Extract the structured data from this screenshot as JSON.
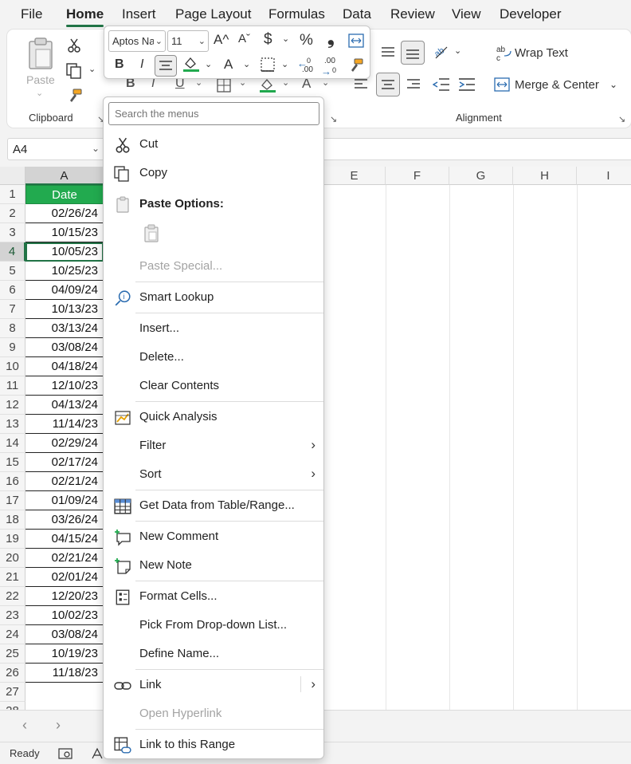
{
  "menu": {
    "tabs": [
      "File",
      "Home",
      "Insert",
      "Page Layout",
      "Formulas",
      "Data",
      "Review",
      "View",
      "Developer"
    ],
    "active_tab": "Home"
  },
  "ribbon": {
    "clipboard": {
      "group_label": "Clipboard",
      "paste_label": "Paste"
    },
    "alignment": {
      "group_label": "Alignment",
      "wrap_text": "Wrap Text",
      "merge_center": "Merge & Center"
    },
    "font_letter": "A"
  },
  "name_box": {
    "value": "A4"
  },
  "grid": {
    "columns": [
      "A",
      "E",
      "F",
      "G",
      "H",
      "I"
    ],
    "header_cell": "Date",
    "row_numbers": [
      "1",
      "2",
      "3",
      "4",
      "5",
      "6",
      "7",
      "8",
      "9",
      "10",
      "11",
      "12",
      "13",
      "14",
      "15",
      "16",
      "17",
      "18",
      "19",
      "20",
      "21",
      "22",
      "23",
      "24",
      "25",
      "26",
      "27",
      "28"
    ],
    "dates": [
      "02/26/24",
      "10/15/23",
      "10/05/23",
      "10/25/23",
      "04/09/24",
      "10/13/23",
      "03/13/24",
      "03/08/24",
      "04/18/24",
      "12/10/23",
      "04/13/24",
      "11/14/23",
      "02/29/24",
      "02/17/24",
      "02/21/24",
      "01/09/24",
      "03/26/24",
      "04/15/24",
      "02/21/24",
      "02/01/24",
      "12/20/23",
      "10/02/23",
      "03/08/24",
      "10/19/23",
      "11/18/23"
    ],
    "selected_cell": "A4"
  },
  "mini_toolbar": {
    "font_name": "Aptos Na",
    "font_size": "11",
    "bold": "B",
    "italic": "I",
    "currency": "$",
    "percent": "%",
    "comma": "❟",
    "grow_font": "A^",
    "shrink_font": "Aˇ",
    "font_color_letter": "A",
    "increase_decimal": ".00",
    "decrease_decimal": ".00",
    "fill_color": "#22aa4f",
    "font_color": "#22aa4f"
  },
  "context_menu": {
    "search_placeholder": "Search the menus",
    "items": {
      "cut": "Cut",
      "copy": "Copy",
      "paste_options": "Paste Options:",
      "paste_special": "Paste Special...",
      "smart_lookup": "Smart Lookup",
      "insert": "Insert...",
      "delete": "Delete...",
      "clear_contents": "Clear Contents",
      "quick_analysis": "Quick Analysis",
      "filter": "Filter",
      "sort": "Sort",
      "get_data": "Get Data from Table/Range...",
      "new_comment": "New Comment",
      "new_note": "New Note",
      "format_cells": "Format Cells...",
      "pick_list": "Pick From Drop-down List...",
      "define_name": "Define Name...",
      "link": "Link",
      "open_hyperlink": "Open Hyperlink",
      "link_range": "Link to this Range"
    }
  },
  "status": {
    "text": "Ready"
  },
  "colors": {
    "accent": "#217346",
    "header_fill": "#22aa4f"
  }
}
